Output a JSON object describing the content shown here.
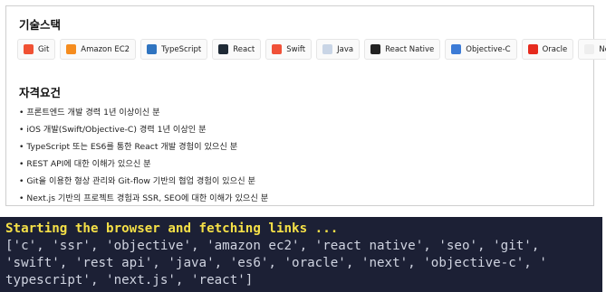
{
  "skills": {
    "title": "기술스택",
    "tags": [
      {
        "label": "Git",
        "icon": "git-icon",
        "color": "#f05133"
      },
      {
        "label": "Amazon EC2",
        "icon": "aws-icon",
        "color": "#f58c1e"
      },
      {
        "label": "TypeScript",
        "icon": "typescript-icon",
        "color": "#2f74c0"
      },
      {
        "label": "React",
        "icon": "react-icon",
        "color": "#1f2a36"
      },
      {
        "label": "Swift",
        "icon": "swift-icon",
        "color": "#f05138"
      },
      {
        "label": "Java",
        "icon": "java-icon",
        "color": "#c9d5e6"
      },
      {
        "label": "React Native",
        "icon": "react-native-icon",
        "color": "#222222"
      },
      {
        "label": "Objective-C",
        "icon": "objective-c-icon",
        "color": "#3c7bd6"
      },
      {
        "label": "Oracle",
        "icon": "oracle-icon",
        "color": "#e62b1e"
      },
      {
        "label": "Next.js",
        "icon": "nextjs-icon",
        "color": "#eeeeee"
      }
    ]
  },
  "requirements": {
    "title": "자격요건",
    "items": [
      "프론트엔드 개발 경력 1년 이상이신 분",
      "iOS 개발(Swift/Objective-C) 경력 1년 이상인 분",
      "TypeScript 또는 ES6를 통한 React 개발 경험이 있으신 분",
      "REST API에 대한 이해가 있으신 분",
      "Git을 이용한 형상 관리와 Git-flow 기반의 협업 경험이 있으신 분",
      "Next.js 기반의 프로젝트 경험과 SSR, SEO에 대한 이해가 있으신 분"
    ]
  },
  "terminal": {
    "header": "Starting the browser and fetching links ...",
    "lines": [
      "['c', 'ssr', 'objective', 'amazon ec2', 'react native', 'seo', 'git',",
      "'swift', 'rest api', 'java', 'es6', 'oracle', 'next', 'objective-c', '",
      "typescript', 'next.js', 'react']"
    ]
  }
}
